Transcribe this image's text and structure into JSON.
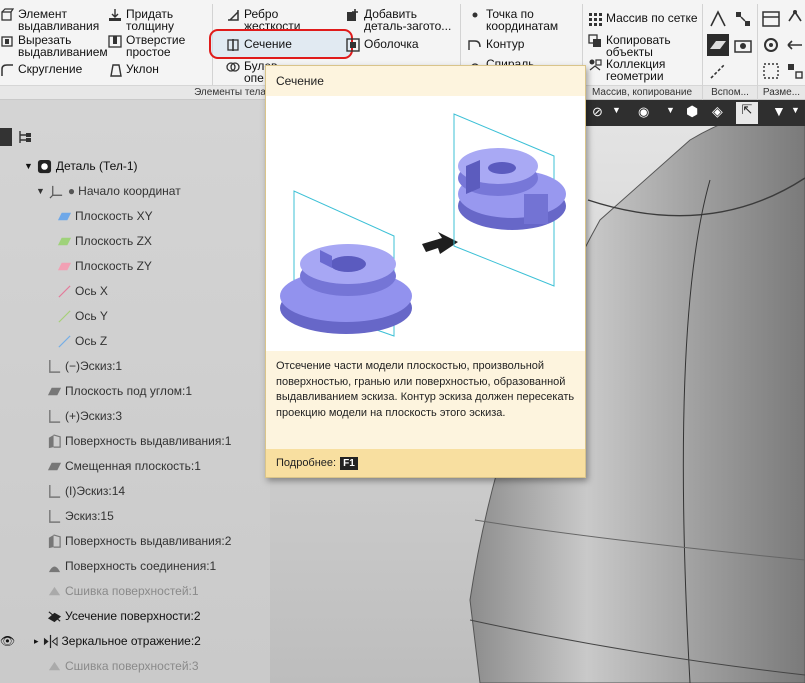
{
  "ribbon": {
    "buttons": {
      "extrude_element": "Элемент выдавливания",
      "extrude_cut": "Вырезать выдавливанием",
      "fillet": "Скругление",
      "add_thickness": "Придать толщину",
      "simple_hole": "Отверстие простое",
      "draft": "Уклон",
      "rib": "Ребро жесткости",
      "section": "Сечение",
      "boolean": "Булева опе...",
      "add_part_blank": "Добавить деталь-загото...",
      "shell": "Оболочка",
      "point_by_coords": "Точка по координатам",
      "contour": "Контур",
      "spiral": "Спираль",
      "grid_array": "Массив по сетке",
      "copy_objects": "Копировать объекты",
      "geometry_collection": "Коллекция геометрии"
    },
    "groups": {
      "body_elements": "Элементы тела",
      "array_copy": "Массив, копирование",
      "auxiliary": "Вспом...",
      "dimensions": "Разме..."
    }
  },
  "tooltip": {
    "title": "Сечение",
    "description": "Отсечение части модели плоскостью, произвольной поверхностью, гранью или поверхностью, образованной выдавливанием эскиза. Контур эскиза должен пересекать проекцию модели на плоскость этого эскиза.",
    "more_label": "Подробнее:",
    "hotkey": "F1"
  },
  "tree": {
    "items": [
      {
        "label": "Деталь (Тел-1)"
      },
      {
        "label": "Начало координат"
      },
      {
        "label": "Плоскость XY"
      },
      {
        "label": "Плоскость ZX"
      },
      {
        "label": "Плоскость ZY"
      },
      {
        "label": "Ось X"
      },
      {
        "label": "Ось Y"
      },
      {
        "label": "Ось Z"
      },
      {
        "label": "(−)Эскиз:1"
      },
      {
        "label": "Плоскость под углом:1"
      },
      {
        "label": "(+)Эскиз:3"
      },
      {
        "label": "Поверхность выдавливания:1"
      },
      {
        "label": "Смещенная плоскость:1"
      },
      {
        "label": "(I)Эскиз:14"
      },
      {
        "label": "Эскиз:15"
      },
      {
        "label": "Поверхность выдавливания:2"
      },
      {
        "label": "Поверхность соединения:1"
      },
      {
        "label": "Сшивка поверхностей:1"
      },
      {
        "label": "Усечение поверхности:2"
      },
      {
        "label": "Зеркальное отражение:2"
      },
      {
        "label": "Сшивка поверхностей:3"
      }
    ]
  },
  "colors": {
    "highlight_border": "#e01b1b",
    "tooltip_bg": "#fdf4de",
    "tooltip_footer": "#f8dfa0",
    "part_blue": "#8f8fe6"
  }
}
